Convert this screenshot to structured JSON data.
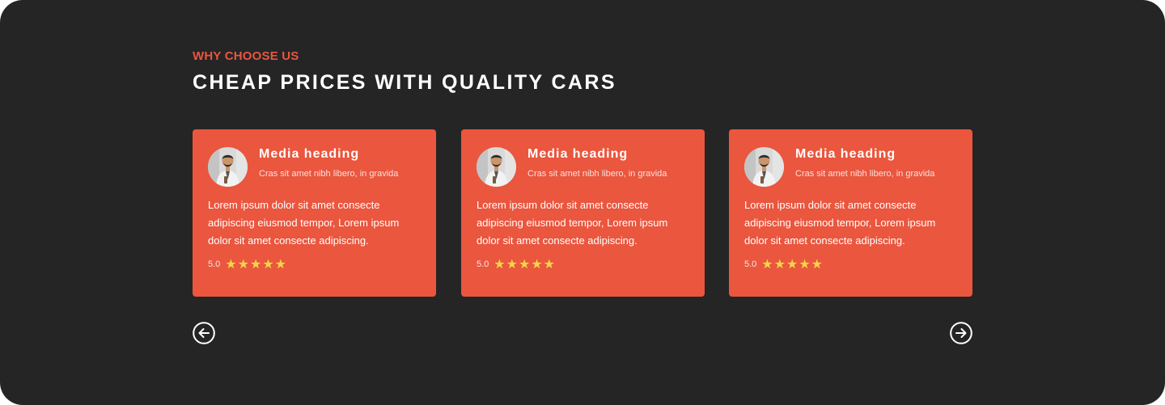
{
  "section": {
    "eyebrow": "WHY CHOOSE US",
    "title": "CHEAP PRICES WITH QUALITY CARS"
  },
  "colors": {
    "background": "#252525",
    "accent": "#EA563E",
    "star": "#F1D649",
    "text": "#FFFFFF"
  },
  "cards": [
    {
      "heading": "Media heading",
      "subtext": "Cras sit amet nibh libero, in gravida",
      "body": "Lorem ipsum dolor sit amet consecte adipiscing eiusmod tempor, Lorem ipsum dolor sit amet consecte adipiscing.",
      "rating_label": "5.0",
      "rating": 5,
      "avatar_icon": "user-avatar-photo"
    },
    {
      "heading": "Media heading",
      "subtext": "Cras sit amet nibh libero, in gravida",
      "body": "Lorem ipsum dolor sit amet consecte adipiscing eiusmod tempor, Lorem ipsum dolor sit amet consecte adipiscing.",
      "rating_label": "5.0",
      "rating": 5,
      "avatar_icon": "user-avatar-photo"
    },
    {
      "heading": "Media heading",
      "subtext": "Cras sit amet nibh libero, in gravida",
      "body": "Lorem ipsum dolor sit amet consecte adipiscing eiusmod tempor, Lorem ipsum dolor sit amet consecte adipiscing.",
      "rating_label": "5.0",
      "rating": 5,
      "avatar_icon": "user-avatar-photo"
    }
  ],
  "navigation": {
    "prev_icon": "arrow-left-circle-icon",
    "next_icon": "arrow-right-circle-icon"
  }
}
